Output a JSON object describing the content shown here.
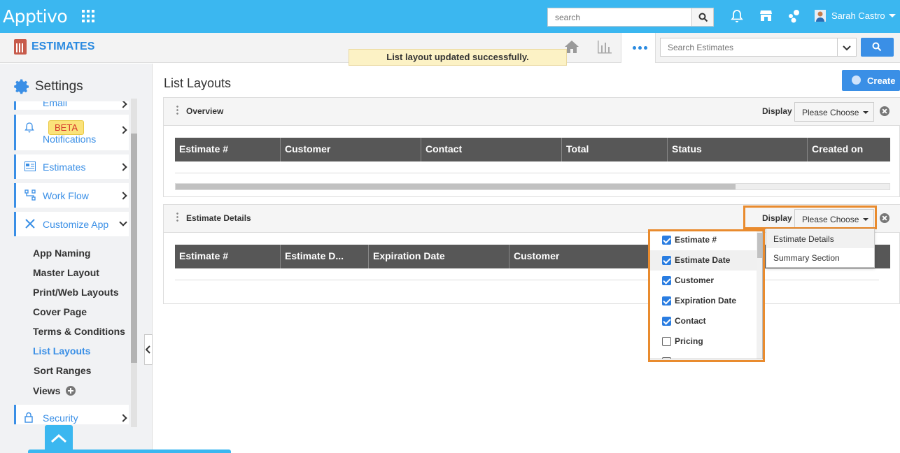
{
  "topbar": {
    "logo": "Apptivo",
    "search_placeholder": "search",
    "user_name": "Sarah Castro"
  },
  "app": {
    "title": "ESTIMATES",
    "search_placeholder": "Search Estimates",
    "toast": "List layout updated successfully."
  },
  "sidebar": {
    "title": "Settings",
    "partial_item": "Email",
    "beta_badge": "BETA",
    "items": [
      {
        "label": "Notifications"
      },
      {
        "label": "Estimates"
      },
      {
        "label": "Work Flow"
      },
      {
        "label": "Customize App"
      },
      {
        "label": "Security"
      }
    ],
    "sub_items": [
      {
        "label": "App Naming"
      },
      {
        "label": "Master Layout"
      },
      {
        "label": "Print/Web Layouts"
      },
      {
        "label": "Cover Page"
      },
      {
        "label": "Terms & Conditions"
      },
      {
        "label": "List Layouts"
      },
      {
        "label": "Sort Ranges"
      },
      {
        "label": "Views"
      }
    ]
  },
  "main": {
    "title": "List Layouts",
    "create_label": "Create",
    "display_label": "Display",
    "choose_label": "Please Choose",
    "panels": [
      {
        "title": "Overview",
        "columns": [
          "Estimate #",
          "Customer",
          "Contact",
          "Total",
          "Status",
          "Created on"
        ]
      },
      {
        "title": "Estimate Details",
        "columns": [
          "Estimate #",
          "Estimate D...",
          "Expiration Date",
          "Customer"
        ]
      }
    ],
    "display_options": [
      "Estimate Details",
      "Summary Section"
    ],
    "column_checklist": [
      {
        "label": "Estimate #",
        "checked": true
      },
      {
        "label": "Estimate Date",
        "checked": true
      },
      {
        "label": "Customer",
        "checked": true
      },
      {
        "label": "Expiration Date",
        "checked": true
      },
      {
        "label": "Contact",
        "checked": true
      },
      {
        "label": "Pricing",
        "checked": false
      }
    ]
  },
  "colors": {
    "topbar": "#3bb7f0",
    "accent": "#3a8fe6",
    "highlight_outline": "#e98b2e",
    "table_header": "#575757"
  }
}
